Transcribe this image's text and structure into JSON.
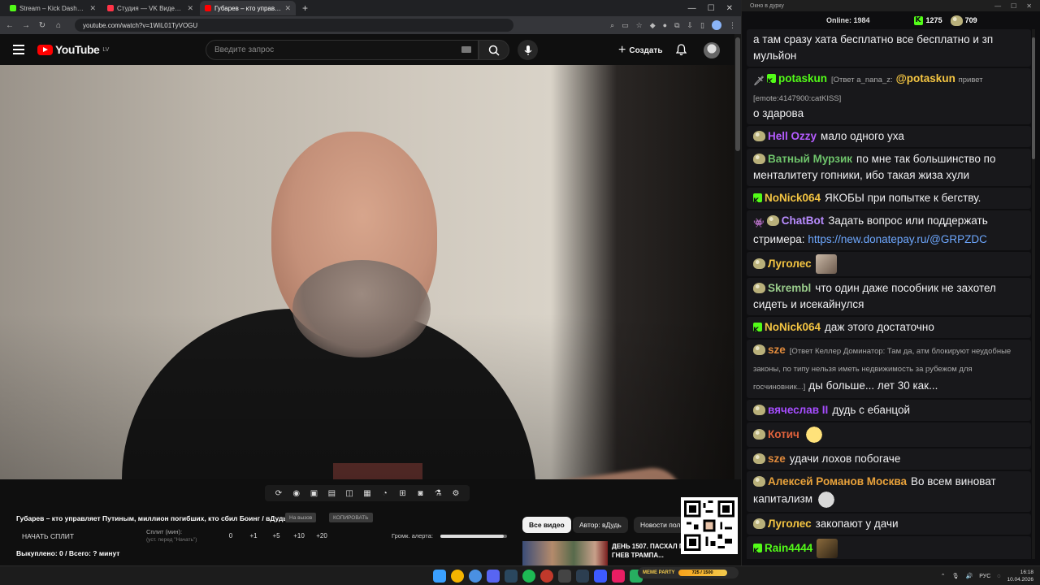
{
  "browser": {
    "tabs": [
      {
        "title": "Stream – Kick Dashboard",
        "color": "#53fc18",
        "active": false
      },
      {
        "title": "Студия — VK Видео Live",
        "color": "#ff3347",
        "active": false
      },
      {
        "title": "Губарев – кто управляет П",
        "color": "#ff0000",
        "active": true
      }
    ],
    "url": "youtube.com/watch?v=1WiL01TyVOGU"
  },
  "youtube": {
    "logo_text": "YouTube",
    "logo_region": "LV",
    "search_placeholder": "Введите запрос",
    "create_label": "Создать"
  },
  "video_info": {
    "title": "Губарев – кто управляет Путиным, миллион погибших, кто сбил Боинг / вДудь",
    "pill_1": "На вызов",
    "pill_2": "КОПИРОВАТЬ",
    "split_button": "НАЧАТЬ СПЛИТ",
    "split_label": "Сплит (мин):",
    "split_hint": "(уст. перед \"Начать\")",
    "split_values": [
      "0",
      "+1",
      "+5",
      "+10",
      "+20"
    ],
    "volume_label": "Громк. алерта:",
    "volume_level": 0.95,
    "bought": "Выкуплено: 0 / Всего: ? минут"
  },
  "filters": {
    "all": "Все видео",
    "author": "Автор: вДудь",
    "news": "Новости пол"
  },
  "recommendation": {
    "title": "ДЕНЬ 1507. ПАСХАЛ ПЕРЕМИРИЕ/ ГНЕВ ТРАМПА..."
  },
  "chat_window": {
    "title": "Окно в дурку",
    "online_label": "Online:",
    "online_count": "1984",
    "kick_count": "1275",
    "other_count": "709"
  },
  "chat": [
    {
      "badge": "none",
      "user": "",
      "user_color": "#efeff1",
      "text": "а там сразу хата бесплатно все бесплатно и зп мульйон"
    },
    {
      "badge": "sword-kick",
      "user": "potaskun",
      "user_color": "#53fc18",
      "reply": "[Ответ a_nana_z:",
      "mention": "@potaskun",
      "text_after": "привет",
      "small": "[emote:4147900:catKISS]",
      "text": "о здарова"
    },
    {
      "badge": "pepe",
      "user": "Hell Ozzy",
      "user_color": "#b55cff",
      "text": "мало одного уха"
    },
    {
      "badge": "pepe",
      "user": "Ватный Мурзик",
      "user_color": "#6ec36b",
      "text": "по мне так большинство по менталитету гопники, ибо такая жиза хули"
    },
    {
      "badge": "kick",
      "user": "NoNick064",
      "user_color": "#f4c542",
      "text": "ЯКОБЫ при попытке к бегству."
    },
    {
      "badge": "bot-pepe",
      "user": "ChatBot",
      "user_color": "#b88cff",
      "text": "Задать вопрос или поддержать стримера:",
      "link": "https://new.donatepay.ru/@GRPZDC"
    },
    {
      "badge": "pepe",
      "user": "Луголес",
      "user_color": "#f4c542",
      "text": "",
      "emote": "photo"
    },
    {
      "badge": "pepe",
      "user": "Skrembl",
      "user_color": "#9acd8c",
      "text": "что один даже пособник не захотел сидеть и исекайнулся"
    },
    {
      "badge": "kick",
      "user": "NoNick064",
      "user_color": "#f4c542",
      "text": "даж этого достаточно"
    },
    {
      "badge": "pepe",
      "user": "sze",
      "user_color": "#e08a3c",
      "reply": "[Ответ Келлер Доминатор: Там да, атм блокируют неудобные законы, по типу нельзя иметь недвижимость за рубежом для госчиновник...]",
      "text": "ды больше... лет 30 как..."
    },
    {
      "badge": "pepe",
      "user": "вячеслав II",
      "user_color": "#a64dff",
      "text": "дудь с ебанцой"
    },
    {
      "badge": "pepe",
      "user": "Котич",
      "user_color": "#e0623c",
      "text": "",
      "emote": "laugh"
    },
    {
      "badge": "pepe",
      "user": "sze",
      "user_color": "#e08a3c",
      "text": "удачи лохов побогаче"
    },
    {
      "badge": "pepe",
      "user": "Алексей Романов Москва",
      "user_color": "#e9a23b",
      "text": "Во всем виноват капитализм",
      "emote": "face"
    },
    {
      "badge": "pepe",
      "user": "Луголес",
      "user_color": "#f4c542",
      "text": "закопают у дачи"
    },
    {
      "badge": "kick",
      "user": "Rain4444",
      "user_color": "#53fc18",
      "text": "",
      "emote": "meme"
    }
  ],
  "taskbar": {
    "lang": "РУС",
    "time": "16:18",
    "date": "10.04.2026",
    "meme_label": "MEME PARTY",
    "meme_progress": "725 / 1500"
  }
}
